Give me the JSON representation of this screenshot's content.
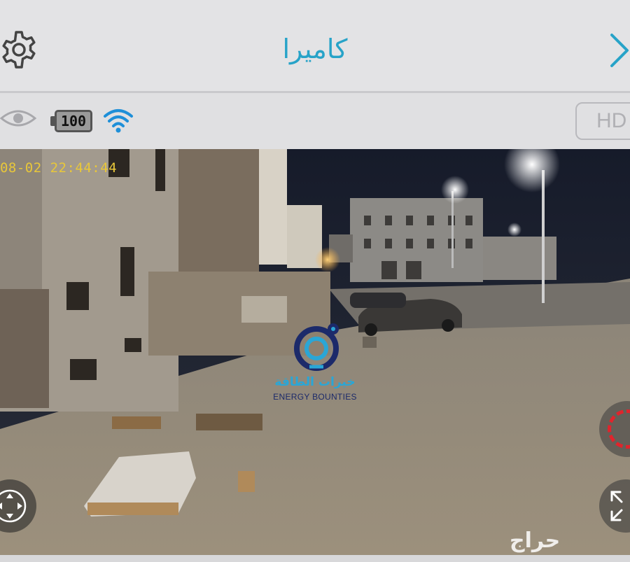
{
  "header": {
    "title": "كاميرا",
    "settings_icon": "gear-icon",
    "close_icon": "close-icon",
    "accent_color": "#27a3c8"
  },
  "status": {
    "eye_icon": "eye-icon",
    "battery_level": "100",
    "wifi_icon": "wifi-icon",
    "quality_label": "HD"
  },
  "video": {
    "timestamp": "-08-02 22:44:44",
    "watermark_ar": "خيرات الطاقة",
    "watermark_en": "ENERGY BOUNTIES",
    "corner_watermark": "حراج",
    "record_icon": "record-icon",
    "fullscreen_icon": "fullscreen-icon",
    "ptz_icon": "joystick-icon",
    "record_color": "#e0242c"
  }
}
